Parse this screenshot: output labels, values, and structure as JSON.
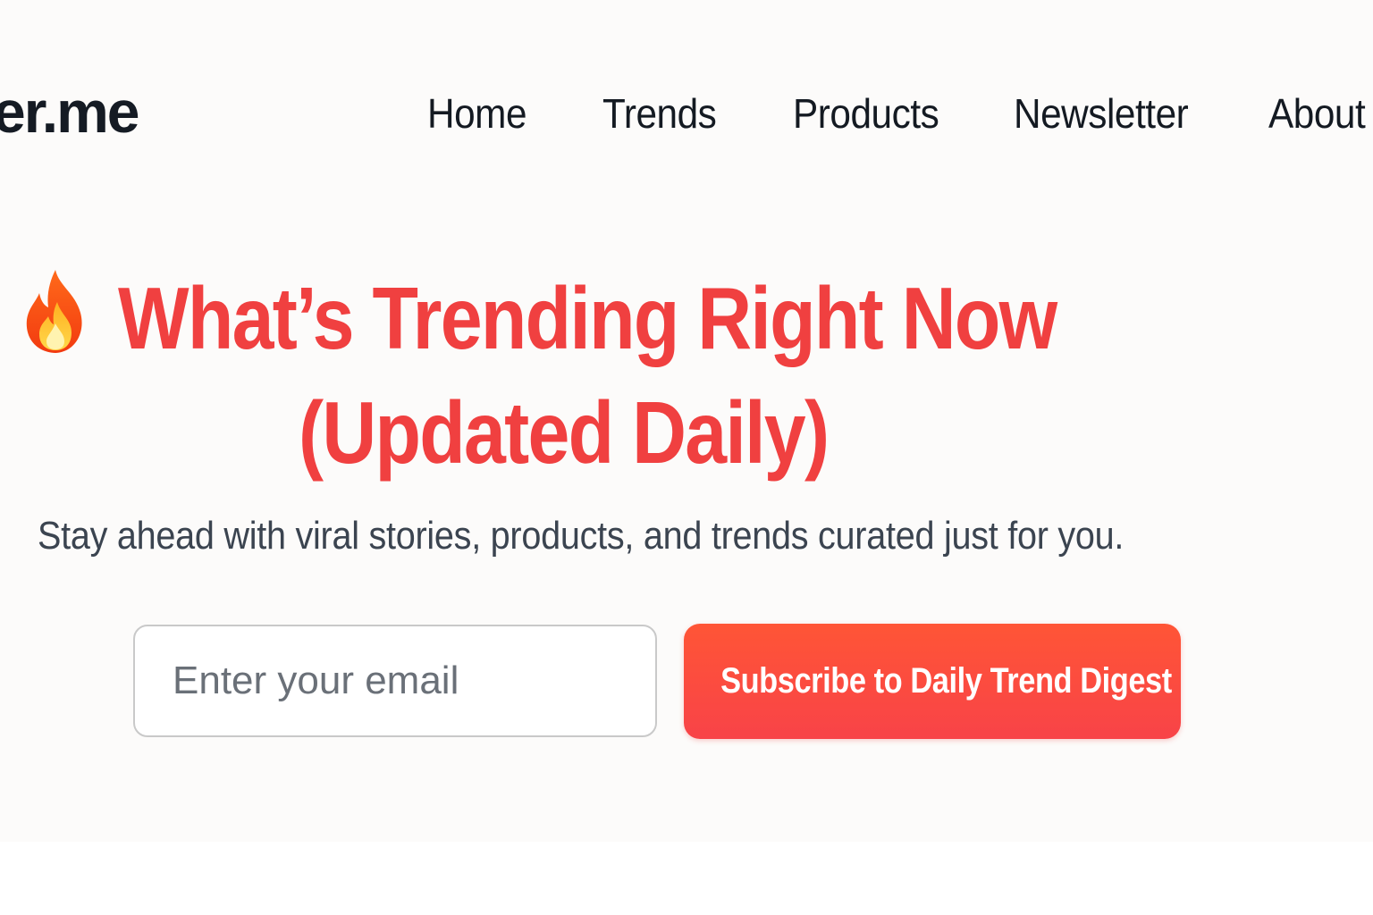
{
  "header": {
    "logo_text": "er.me",
    "nav": [
      {
        "label": "Home"
      },
      {
        "label": "Trends"
      },
      {
        "label": "Products"
      },
      {
        "label": "Newsletter"
      },
      {
        "label": "About"
      }
    ]
  },
  "hero": {
    "title_line1": "What’s Trending Right Now",
    "title_line2": "(Updated Daily)",
    "icon": "fire-icon",
    "subtitle": "Stay ahead with viral stories, products, and trends curated  just for you."
  },
  "signup": {
    "email_placeholder": "Enter your email",
    "email_value": "",
    "button_label": "Subscribe to Daily Trend Digest"
  },
  "colors": {
    "accent": "#f04040",
    "button_gradient_top": "#ff5536",
    "button_gradient_bottom": "#f84348",
    "page_background": "#fcfbfa",
    "text_dark": "#141a22",
    "text_muted": "#3b4450"
  }
}
